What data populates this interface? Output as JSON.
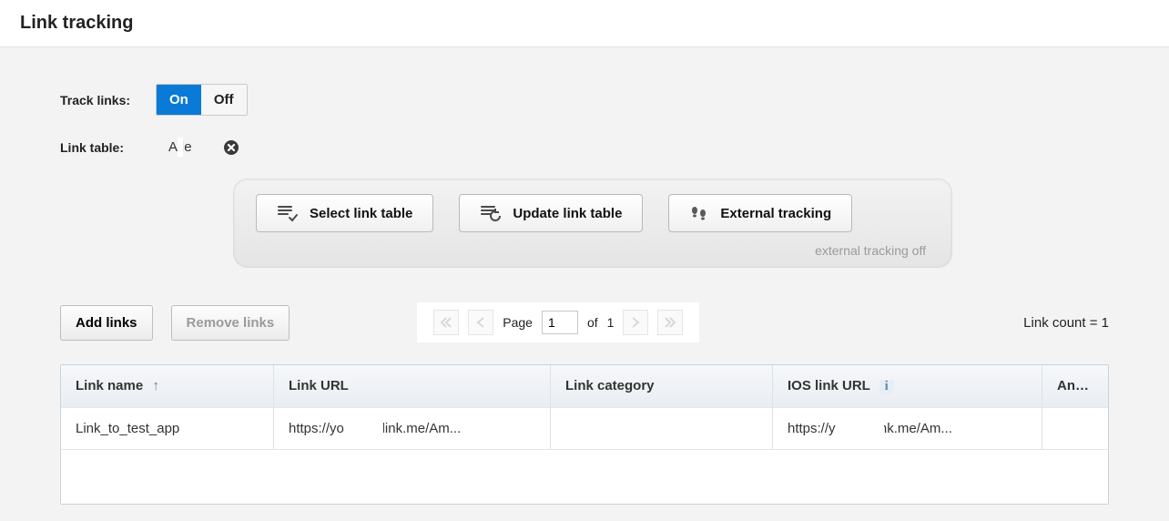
{
  "header": {
    "title": "Link tracking"
  },
  "track_links": {
    "label": "Track links:",
    "options": {
      "on": "On",
      "off": "Off"
    },
    "value": "On"
  },
  "link_table": {
    "label": "Link table:",
    "value": "A                    le"
  },
  "action_panel": {
    "select": "Select link table",
    "update": "Update link table",
    "external": "External tracking",
    "external_note": "external tracking off"
  },
  "toolbar": {
    "add_links": "Add links",
    "remove_links": "Remove links"
  },
  "pager": {
    "page_label": "Page",
    "current": "1",
    "of_label": "of",
    "total": "1"
  },
  "link_count": {
    "prefix": "Link count = ",
    "value": "1"
  },
  "table": {
    "columns": {
      "name": "Link name",
      "url": "Link URL",
      "category": "Link category",
      "ios": "IOS link URL",
      "android": "Andro"
    },
    "rows": [
      {
        "name": "Link_to_test_app",
        "url": "https://yo        p.onelink.me/Am...",
        "category": "",
        "ios": "https://y         p.onelink.me/Am...",
        "android": ""
      }
    ]
  }
}
